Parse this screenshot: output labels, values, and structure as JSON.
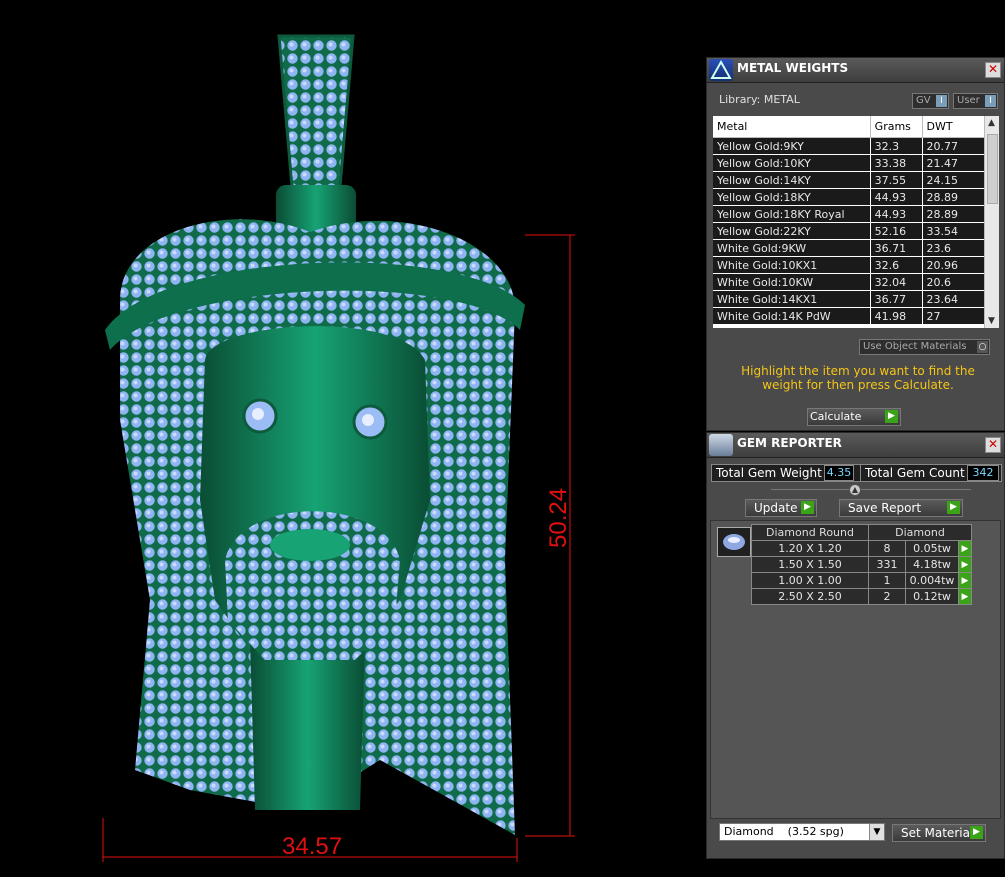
{
  "viewport": {
    "dim_width": "34.57",
    "dim_height": "50.24",
    "accent_color": "#e01010"
  },
  "metal_panel": {
    "title": "METAL WEIGHTS",
    "library_label": "Library: METAL",
    "gv_label": "GV",
    "user_label": "User",
    "columns": [
      "Metal",
      "Grams",
      "DWT"
    ],
    "rows": [
      [
        "Yellow Gold:9KY",
        "32.3",
        "20.77"
      ],
      [
        "Yellow Gold:10KY",
        "33.38",
        "21.47"
      ],
      [
        "Yellow Gold:14KY",
        "37.55",
        "24.15"
      ],
      [
        "Yellow Gold:18KY",
        "44.93",
        "28.89"
      ],
      [
        "Yellow Gold:18KY Royal",
        "44.93",
        "28.89"
      ],
      [
        "Yellow Gold:22KY",
        "52.16",
        "33.54"
      ],
      [
        "White Gold:9KW",
        "36.71",
        "23.6"
      ],
      [
        "White Gold:10KX1",
        "32.6",
        "20.96"
      ],
      [
        "White Gold:10KW",
        "32.04",
        "20.6"
      ],
      [
        "White Gold:14KX1",
        "36.77",
        "23.64"
      ],
      [
        "White Gold:14K PdW",
        "41.98",
        "27"
      ]
    ],
    "use_object_materials": "Use Object Materials",
    "hint": "Highlight the item you want to find the weight for then press Calculate.",
    "calculate_label": "Calculate"
  },
  "gem_panel": {
    "title": "GEM REPORTER",
    "total_weight_label": "Total Gem Weight",
    "total_weight_value": "4.35",
    "total_count_label": "Total Gem Count",
    "total_count_value": "342",
    "update_label": "Update",
    "save_report_label": "Save Report",
    "header_shape": "Diamond Round",
    "header_material": "Diamond",
    "rows": [
      [
        "1.20 X 1.20",
        "8",
        "0.05tw"
      ],
      [
        "1.50 X 1.50",
        "331",
        "4.18tw"
      ],
      [
        "1.00 X 1.00",
        "1",
        "0.004tw"
      ],
      [
        "2.50 X 2.50",
        "2",
        "0.12tw"
      ]
    ],
    "material_select": "Diamond    (3.52 spg)",
    "set_material_label": "Set Material"
  }
}
